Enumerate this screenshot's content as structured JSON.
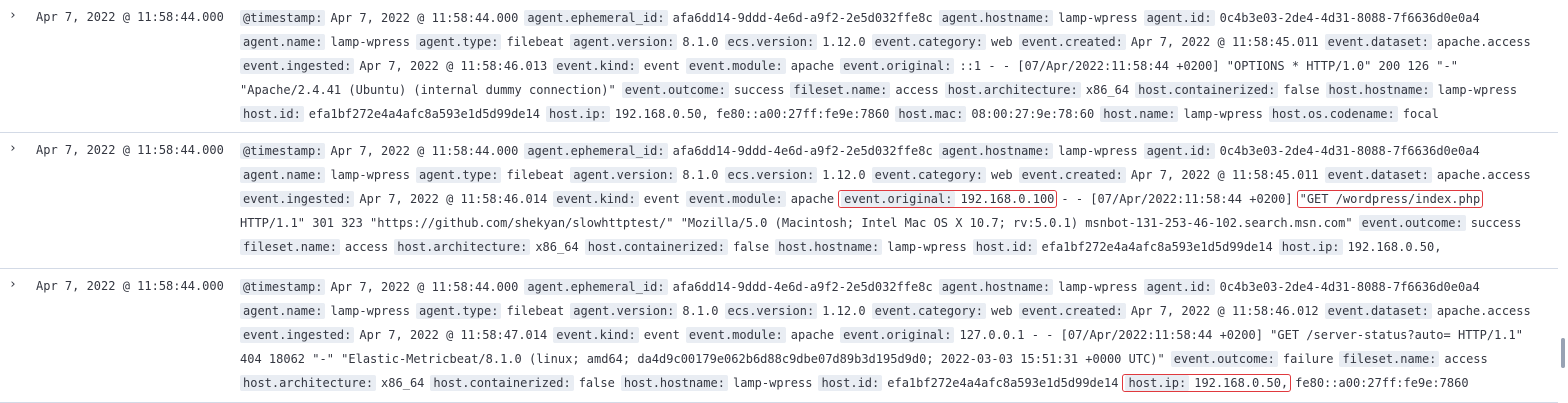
{
  "rows": [
    {
      "toggle_icon": "chevron-right-icon",
      "timestamp": "Apr 7, 2022 @ 11:58:44.000",
      "lines": [
        [
          {
            "k": "@timestamp:",
            "v": "Apr 7, 2022 @ 11:58:44.000"
          },
          {
            "k": "agent.ephemeral_id:",
            "v": "afa6dd14-9ddd-4e6d-a9f2-2e5d032ffe8c"
          },
          {
            "k": "agent.hostname:",
            "v": "lamp-wpress"
          },
          {
            "k": "agent.id:",
            "v": "0c4b3e03-2de4-4d31-8088-7f6636d0e0a4"
          }
        ],
        [
          {
            "k": "agent.name:",
            "v": "lamp-wpress"
          },
          {
            "k": "agent.type:",
            "v": "filebeat"
          },
          {
            "k": "agent.version:",
            "v": "8.1.0"
          },
          {
            "k": "ecs.version:",
            "v": "1.12.0"
          },
          {
            "k": "event.category:",
            "v": "web"
          },
          {
            "k": "event.created:",
            "v": "Apr 7, 2022 @ 11:58:45.011"
          },
          {
            "k": "event.dataset:",
            "v": "apache.access"
          }
        ],
        [
          {
            "k": "event.ingested:",
            "v": "Apr 7, 2022 @ 11:58:46.013"
          },
          {
            "k": "event.kind:",
            "v": "event"
          },
          {
            "k": "event.module:",
            "v": "apache"
          },
          {
            "k": "event.original:",
            "v": "::1 - - [07/Apr/2022:11:58:44 +0200] \"OPTIONS * HTTP/1.0\" 200 126 \"-\""
          }
        ],
        [
          {
            "v": "\"Apache/2.4.41 (Ubuntu) (internal dummy connection)\""
          },
          {
            "k": "event.outcome:",
            "v": "success"
          },
          {
            "k": "fileset.name:",
            "v": "access"
          },
          {
            "k": "host.architecture:",
            "v": "x86_64"
          },
          {
            "k": "host.containerized:",
            "v": "false"
          },
          {
            "k": "host.hostname:",
            "v": "lamp-wpress"
          }
        ],
        [
          {
            "k": "host.id:",
            "v": "efa1bf272e4a4afc8a593e1d5d99de14"
          },
          {
            "k": "host.ip:",
            "v": "192.168.0.50, fe80::a00:27ff:fe9e:7860"
          },
          {
            "k": "host.mac:",
            "v": "08:00:27:9e:78:60"
          },
          {
            "k": "host.name:",
            "v": "lamp-wpress"
          },
          {
            "k": "host.os.codename:",
            "v": "focal"
          }
        ]
      ]
    },
    {
      "toggle_icon": "chevron-right-icon",
      "timestamp": "Apr 7, 2022 @ 11:58:44.000",
      "lines": [
        [
          {
            "k": "@timestamp:",
            "v": "Apr 7, 2022 @ 11:58:44.000"
          },
          {
            "k": "agent.ephemeral_id:",
            "v": "afa6dd14-9ddd-4e6d-a9f2-2e5d032ffe8c"
          },
          {
            "k": "agent.hostname:",
            "v": "lamp-wpress"
          },
          {
            "k": "agent.id:",
            "v": "0c4b3e03-2de4-4d31-8088-7f6636d0e0a4"
          }
        ],
        [
          {
            "k": "agent.name:",
            "v": "lamp-wpress"
          },
          {
            "k": "agent.type:",
            "v": "filebeat"
          },
          {
            "k": "agent.version:",
            "v": "8.1.0"
          },
          {
            "k": "ecs.version:",
            "v": "1.12.0"
          },
          {
            "k": "event.category:",
            "v": "web"
          },
          {
            "k": "event.created:",
            "v": "Apr 7, 2022 @ 11:58:45.011"
          },
          {
            "k": "event.dataset:",
            "v": "apache.access"
          }
        ],
        [
          {
            "k": "event.ingested:",
            "v": "Apr 7, 2022 @ 11:58:46.014"
          },
          {
            "k": "event.kind:",
            "v": "event"
          },
          {
            "k": "event.module:",
            "v": "apache"
          },
          {
            "k": "event.original:",
            "v": "192.168.0.100",
            "hl": true
          },
          {
            "v": "- - [07/Apr/2022:11:58:44 +0200]"
          },
          {
            "v": "\"GET /wordpress/index.php",
            "hl": true
          }
        ],
        [
          {
            "v": "HTTP/1.1\" 301 323 \"https://github.com/shekyan/slowhttptest/\" \"Mozilla/5.0 (Macintosh; Intel Mac OS X 10.7; rv:5.0.1) msnbot-131-253-46-102.search.msn.com\""
          },
          {
            "k": "event.outcome:",
            "v": "success"
          }
        ],
        [
          {
            "k": "fileset.name:",
            "v": "access"
          },
          {
            "k": "host.architecture:",
            "v": "x86_64"
          },
          {
            "k": "host.containerized:",
            "v": "false"
          },
          {
            "k": "host.hostname:",
            "v": "lamp-wpress"
          },
          {
            "k": "host.id:",
            "v": "efa1bf272e4a4afc8a593e1d5d99de14"
          },
          {
            "k": "host.ip:",
            "v": "192.168.0.50,"
          }
        ]
      ]
    },
    {
      "toggle_icon": "chevron-right-icon",
      "timestamp": "Apr 7, 2022 @ 11:58:44.000",
      "lines": [
        [
          {
            "k": "@timestamp:",
            "v": "Apr 7, 2022 @ 11:58:44.000"
          },
          {
            "k": "agent.ephemeral_id:",
            "v": "afa6dd14-9ddd-4e6d-a9f2-2e5d032ffe8c"
          },
          {
            "k": "agent.hostname:",
            "v": "lamp-wpress"
          },
          {
            "k": "agent.id:",
            "v": "0c4b3e03-2de4-4d31-8088-7f6636d0e0a4"
          }
        ],
        [
          {
            "k": "agent.name:",
            "v": "lamp-wpress"
          },
          {
            "k": "agent.type:",
            "v": "filebeat"
          },
          {
            "k": "agent.version:",
            "v": "8.1.0"
          },
          {
            "k": "ecs.version:",
            "v": "1.12.0"
          },
          {
            "k": "event.category:",
            "v": "web"
          },
          {
            "k": "event.created:",
            "v": "Apr 7, 2022 @ 11:58:46.012"
          },
          {
            "k": "event.dataset:",
            "v": "apache.access"
          }
        ],
        [
          {
            "k": "event.ingested:",
            "v": "Apr 7, 2022 @ 11:58:47.014"
          },
          {
            "k": "event.kind:",
            "v": "event"
          },
          {
            "k": "event.module:",
            "v": "apache"
          },
          {
            "k": "event.original:",
            "v": "127.0.0.1 - - [07/Apr/2022:11:58:44 +0200] \"GET /server-status?auto= HTTP/1.1\""
          }
        ],
        [
          {
            "v": "404 18062 \"-\" \"Elastic-Metricbeat/8.1.0 (linux; amd64; da4d9c00179e062b6d88c9dbe07d89b3d195d9d0; 2022-03-03 15:51:31 +0000 UTC)\""
          },
          {
            "k": "event.outcome:",
            "v": "failure"
          },
          {
            "k": "fileset.name:",
            "v": "access"
          }
        ],
        [
          {
            "k": "host.architecture:",
            "v": "x86_64"
          },
          {
            "k": "host.containerized:",
            "v": "false"
          },
          {
            "k": "host.hostname:",
            "v": "lamp-wpress"
          },
          {
            "k": "host.id:",
            "v": "efa1bf272e4a4afc8a593e1d5d99de14"
          },
          {
            "k": "host.ip:",
            "v": "192.168.0.50,",
            "hl": true
          },
          {
            "v": "fe80::a00:27ff:fe9e:7860"
          }
        ]
      ]
    }
  ],
  "colors": {
    "key_bg": "#e9edf3",
    "highlight": "#e0393e",
    "divider": "#d3dae6"
  }
}
